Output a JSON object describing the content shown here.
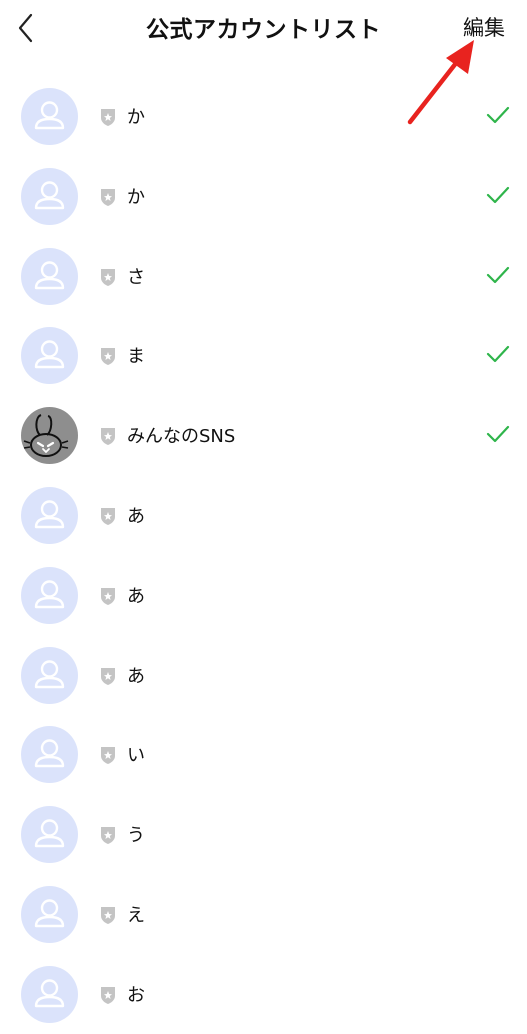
{
  "header": {
    "title": "公式アカウントリスト",
    "edit_label": "編集"
  },
  "colors": {
    "avatar_bg": "#dbe3fb",
    "avatar_icon": "#ffffff",
    "check": "#2fb54b",
    "shield": "#c4c4c4",
    "annotation_arrow": "#e8231f"
  },
  "accounts": [
    {
      "name": "か",
      "checked": true,
      "avatar": "default-avatar-icon"
    },
    {
      "name": "か",
      "checked": true,
      "avatar": "default-avatar-icon"
    },
    {
      "name": "さ",
      "checked": true,
      "avatar": "default-avatar-icon"
    },
    {
      "name": "ま",
      "checked": true,
      "avatar": "default-avatar-icon"
    },
    {
      "name": "みんなのSNS",
      "checked": true,
      "avatar": "rabbit-avatar"
    },
    {
      "name": "あ",
      "checked": false,
      "avatar": "default-avatar-icon"
    },
    {
      "name": "あ",
      "checked": false,
      "avatar": "default-avatar-icon"
    },
    {
      "name": "あ",
      "checked": false,
      "avatar": "default-avatar-icon"
    },
    {
      "name": "い",
      "checked": false,
      "avatar": "default-avatar-icon"
    },
    {
      "name": "う",
      "checked": false,
      "avatar": "default-avatar-icon"
    },
    {
      "name": "え",
      "checked": false,
      "avatar": "default-avatar-icon"
    },
    {
      "name": "お",
      "checked": false,
      "avatar": "default-avatar-icon"
    }
  ]
}
